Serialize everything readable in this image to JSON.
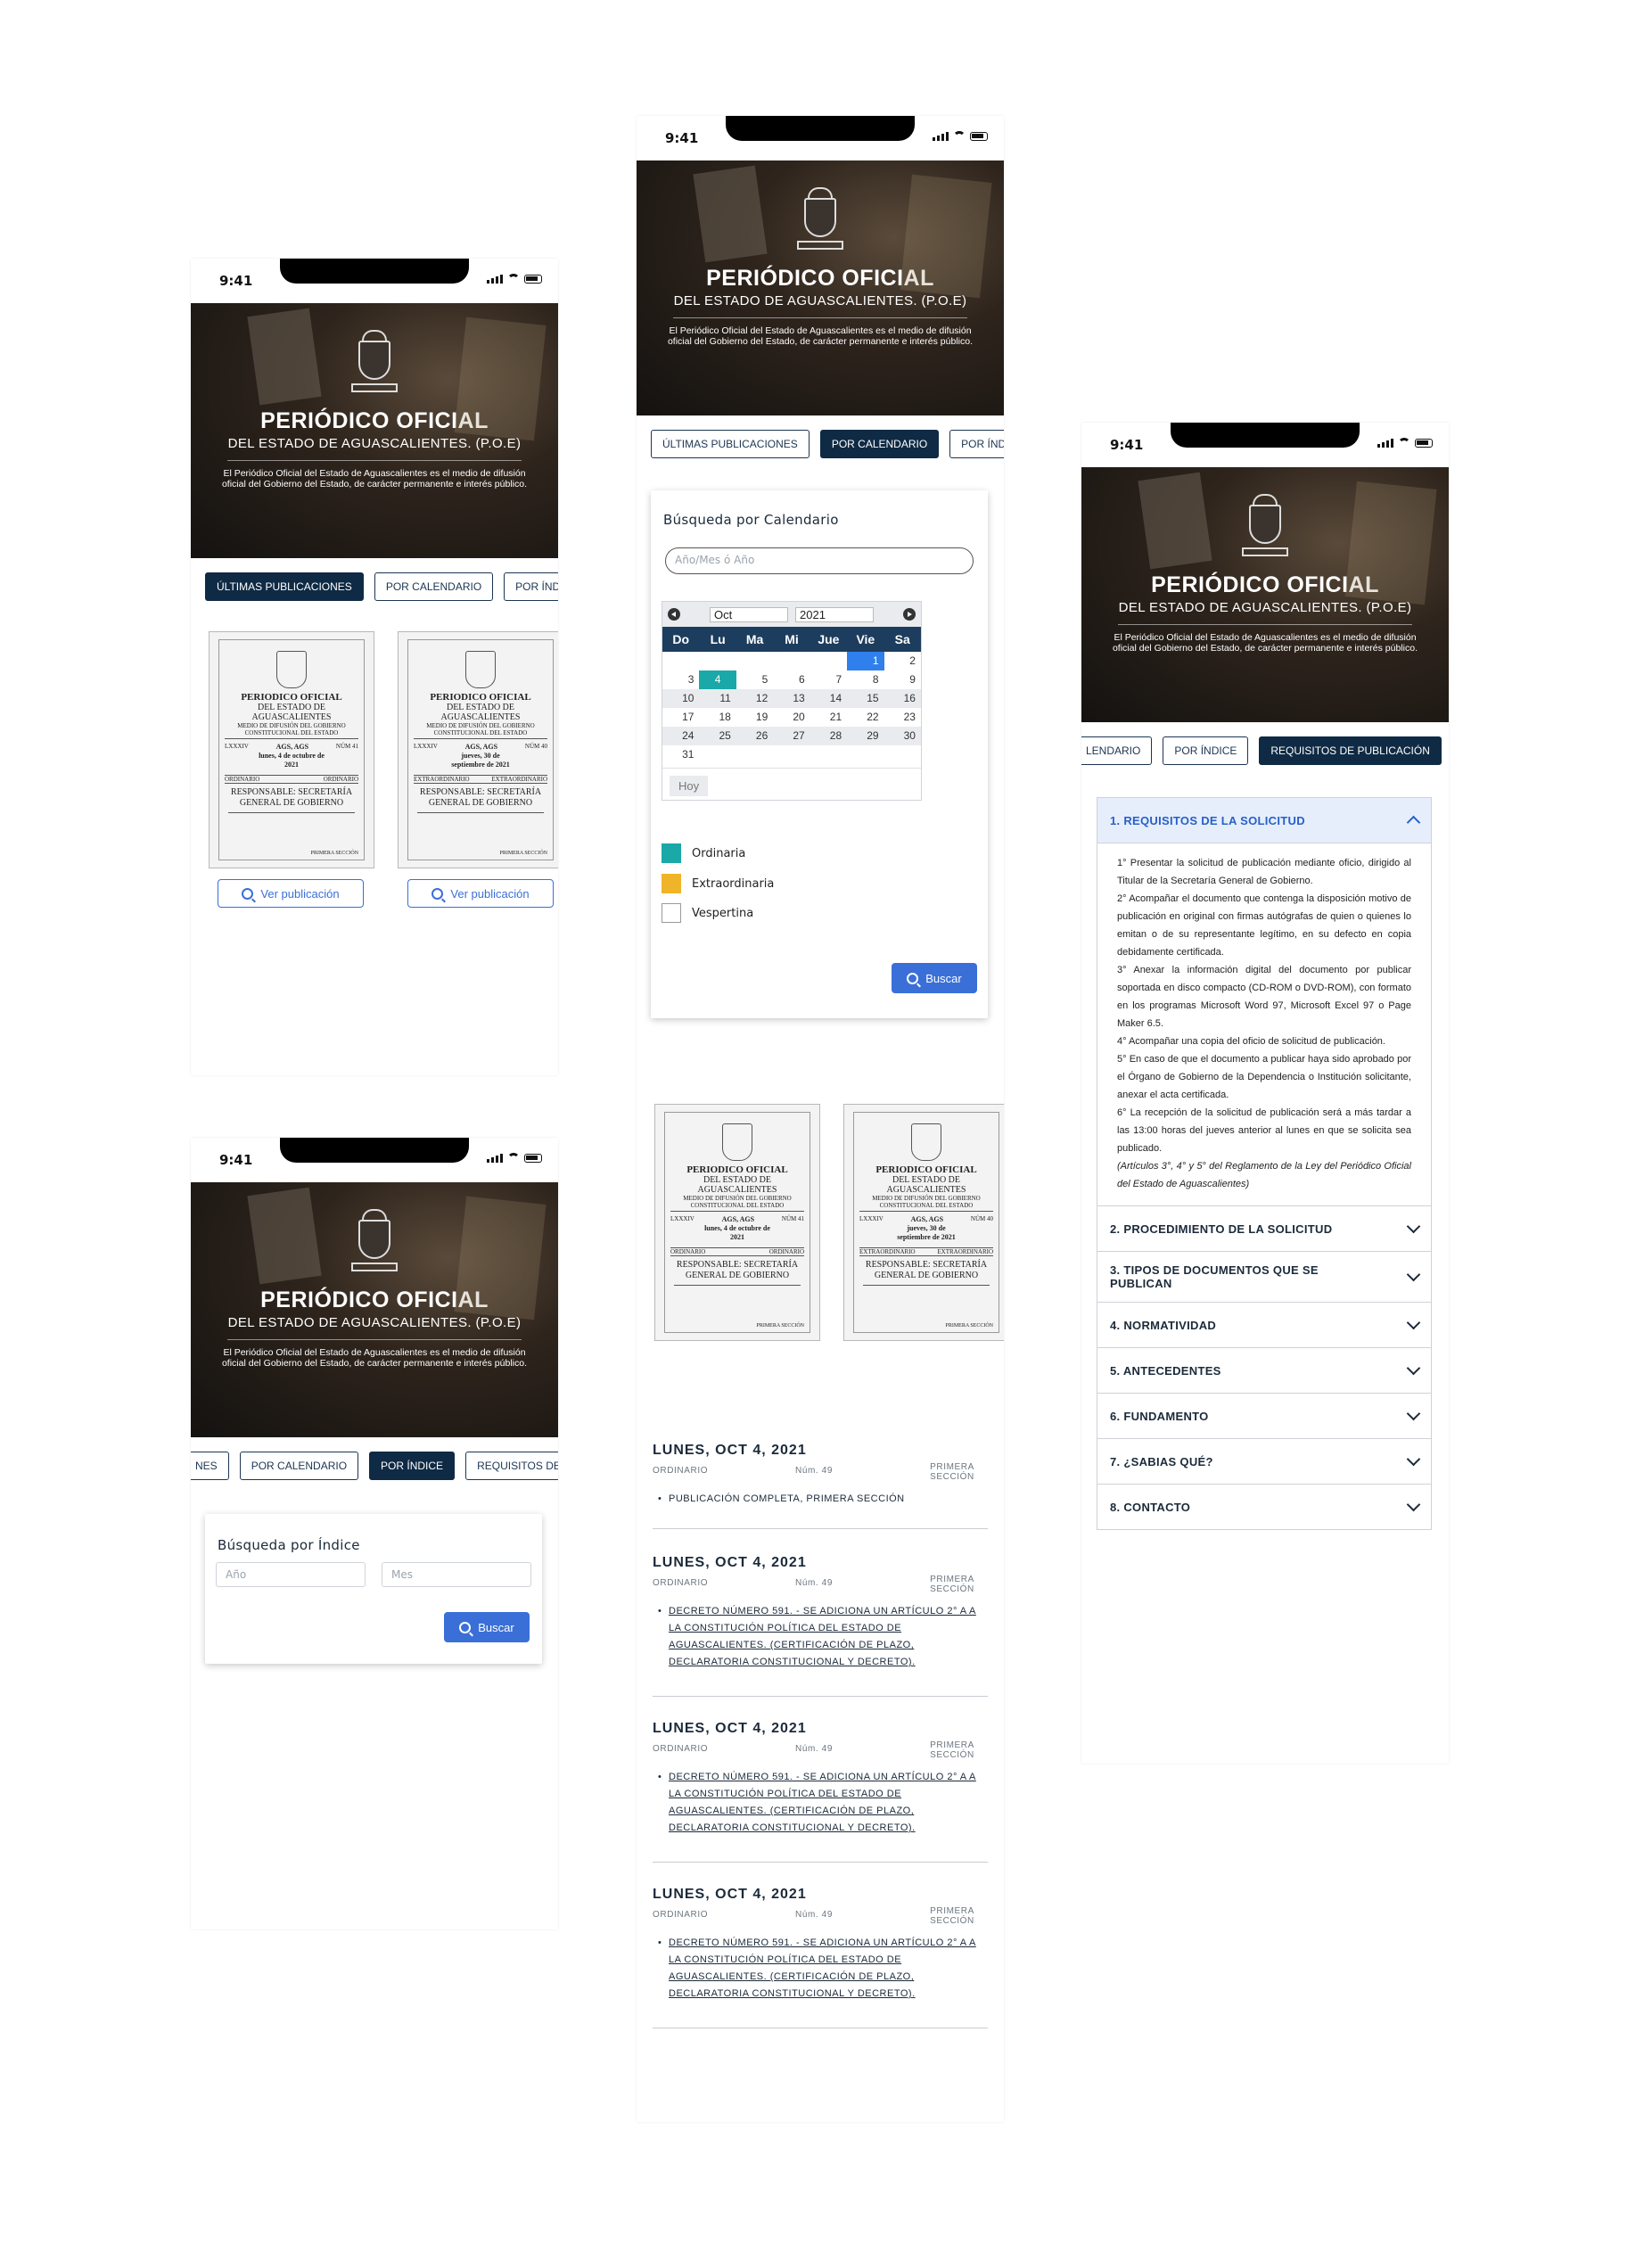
{
  "status": {
    "time": "9:41"
  },
  "hero": {
    "title": "PERIÓDICO OFICIAL",
    "subtitle": "DEL ESTADO DE AGUASCALIENTES. (P.O.E)",
    "description": "El Periódico Oficial del Estado de Aguascalientes es el medio de difusión oficial del Gobierno del Estado, de carácter permanente e interés público."
  },
  "tabs": {
    "ultimas": "ÚLTIMAS PUBLICACIONES",
    "calendario": "POR CALENDARIO",
    "indice": "POR ÍNDICE",
    "indice_cut": "POR ÍND",
    "requisitos": "REQUISITOS DE PUBLICACIÓN",
    "requisitos_cut": "REQUISITOS DE P",
    "ultimas_cut": "NES",
    "calendario_cut": "LENDARIO"
  },
  "publications": [
    {
      "title": "PERIODICO OFICIAL",
      "line1": "DEL ESTADO DE",
      "line2": "AGUASCALIENTES",
      "medio": "MEDIO DE DIFUSIÓN DEL GOBIERNO CONSTITUCIONAL DEL ESTADO",
      "tomo": "LXXXIV",
      "place": "AGS, AGS",
      "date": "lunes, 4 de octubre de 2021",
      "num": "NÚM 41",
      "type_left": "ORDINARIO",
      "type_right": "ORDINARIO",
      "resp": "RESPONSABLE: SECRETARÍA GENERAL DE GOBIERNO",
      "section": "PRIMERA SECCIÓN"
    },
    {
      "title": "PERIODICO OFICIAL",
      "line1": "DEL ESTADO DE",
      "line2": "AGUASCALIENTES",
      "medio": "MEDIO DE DIFUSIÓN DEL GOBIERNO CONSTITUCIONAL DEL ESTADO",
      "tomo": "LXXXIV",
      "place": "AGS, AGS",
      "date": "jueves, 30 de septiembre de 2021",
      "num": "NÚM 40",
      "type_left": "EXTRAORDINARIO",
      "type_right": "EXTRAORDINARIO",
      "resp": "RESPONSABLE: SECRETARÍA GENERAL DE GOBIERNO",
      "section": "PRIMERA SECCIÓN"
    }
  ],
  "ver_publicacion": "Ver publicación",
  "indice_search": {
    "title": "Búsqueda por Índice",
    "year_placeholder": "Año",
    "month_placeholder": "Mes",
    "button": "Buscar"
  },
  "calendar_search": {
    "title": "Búsqueda por Calendario",
    "placeholder": "Año/Mes ó Año",
    "month": "Oct",
    "year": "2021",
    "weekdays": [
      "Do",
      "Lu",
      "Ma",
      "Mi",
      "Jue",
      "Vie",
      "Sa"
    ],
    "today_button": "Hoy",
    "legend": [
      "Ordinaria",
      "Extraordinaria",
      "Vespertina"
    ],
    "button": "Buscar"
  },
  "colors": {
    "ordinaria": "#1aa8a8",
    "extraordinaria": "#f0b429",
    "vespertina": "#ffffff",
    "navy": "#0f2a44",
    "accent": "#3a6fd8"
  },
  "entries": [
    {
      "date": "LUNES, OCT 4, 2021",
      "type": "ORDINARIO",
      "num": "Núm. 49",
      "section": "PRIMERA SECCIÓN",
      "items": [
        "PUBLICACIÓN COMPLETA, PRIMERA SECCIÓN"
      ]
    },
    {
      "date": "LUNES, OCT 4, 2021",
      "type": "ORDINARIO",
      "num": "Núm. 49",
      "section": "PRIMERA SECCIÓN",
      "items": [
        "DECRETO NÚMERO 591. - SE ADICIONA UN ARTÍCULO 2° A A LA CONSTITUCIÓN POLÍTICA DEL ESTADO DE AGUASCALIENTES. (CERTIFICACIÓN DE PLAZO, DECLARATORIA CONSTITUCIONAL Y DECRETO)."
      ]
    },
    {
      "date": "LUNES, OCT 4, 2021",
      "type": "ORDINARIO",
      "num": "Núm. 49",
      "section": "PRIMERA SECCIÓN",
      "items": [
        "DECRETO NÚMERO 591. - SE ADICIONA UN ARTÍCULO 2° A A LA CONSTITUCIÓN POLÍTICA DEL ESTADO DE AGUASCALIENTES. (CERTIFICACIÓN DE PLAZO, DECLARATORIA CONSTITUCIONAL Y DECRETO)."
      ]
    },
    {
      "date": "LUNES, OCT 4, 2021",
      "type": "ORDINARIO",
      "num": "Núm. 49",
      "section": "PRIMERA SECCIÓN",
      "items": [
        "DECRETO NÚMERO 591. - SE ADICIONA UN ARTÍCULO 2° A A LA CONSTITUCIÓN POLÍTICA DEL ESTADO DE AGUASCALIENTES. (CERTIFICACIÓN DE PLAZO, DECLARATORIA CONSTITUCIONAL Y DECRETO)."
      ]
    }
  ],
  "requisitos": {
    "sections": [
      "1. REQUISITOS DE LA SOLICITUD",
      "2. PROCEDIMIENTO DE LA SOLICITUD",
      "3. TIPOS DE DOCUMENTOS QUE SE PUBLICAN",
      "4. NORMATIVIDAD",
      "5. ANTECEDENTES",
      "6. FUNDAMENTO",
      "7. ¿SABIAS QUÉ?",
      "8. CONTACTO"
    ],
    "body": [
      "1° Presentar la solicitud de publicación mediante oficio, dirigido al Titular de la Secretaría General de Gobierno.",
      "2° Acompañar el documento que contenga la disposición motivo de publicación en original con firmas autógrafas de quien o quienes lo emitan o de su representante legítimo, en su defecto en copia debidamente certificada.",
      "3° Anexar la información digital del documento por publicar soportada en disco compacto (CD-ROM o DVD-ROM), con formato en los programas Microsoft Word 97, Microsoft Excel 97 o Page Maker 6.5.",
      "4° Acompañar una copia del oficio de solicitud de publicación.",
      "5° En caso de que el documento a publicar haya sido aprobado por el Órgano de Gobierno de la Dependencia o Institución solicitante, anexar el acta certificada.",
      "6° La recepción de la solicitud de publicación será a más tardar a las 13:00 horas del jueves anterior al lunes en que se solicita sea publicado.",
      "(Artículos 3°, 4° y 5° del Reglamento de la Ley del Periódico Oficial del Estado de Aguascalientes)"
    ]
  }
}
